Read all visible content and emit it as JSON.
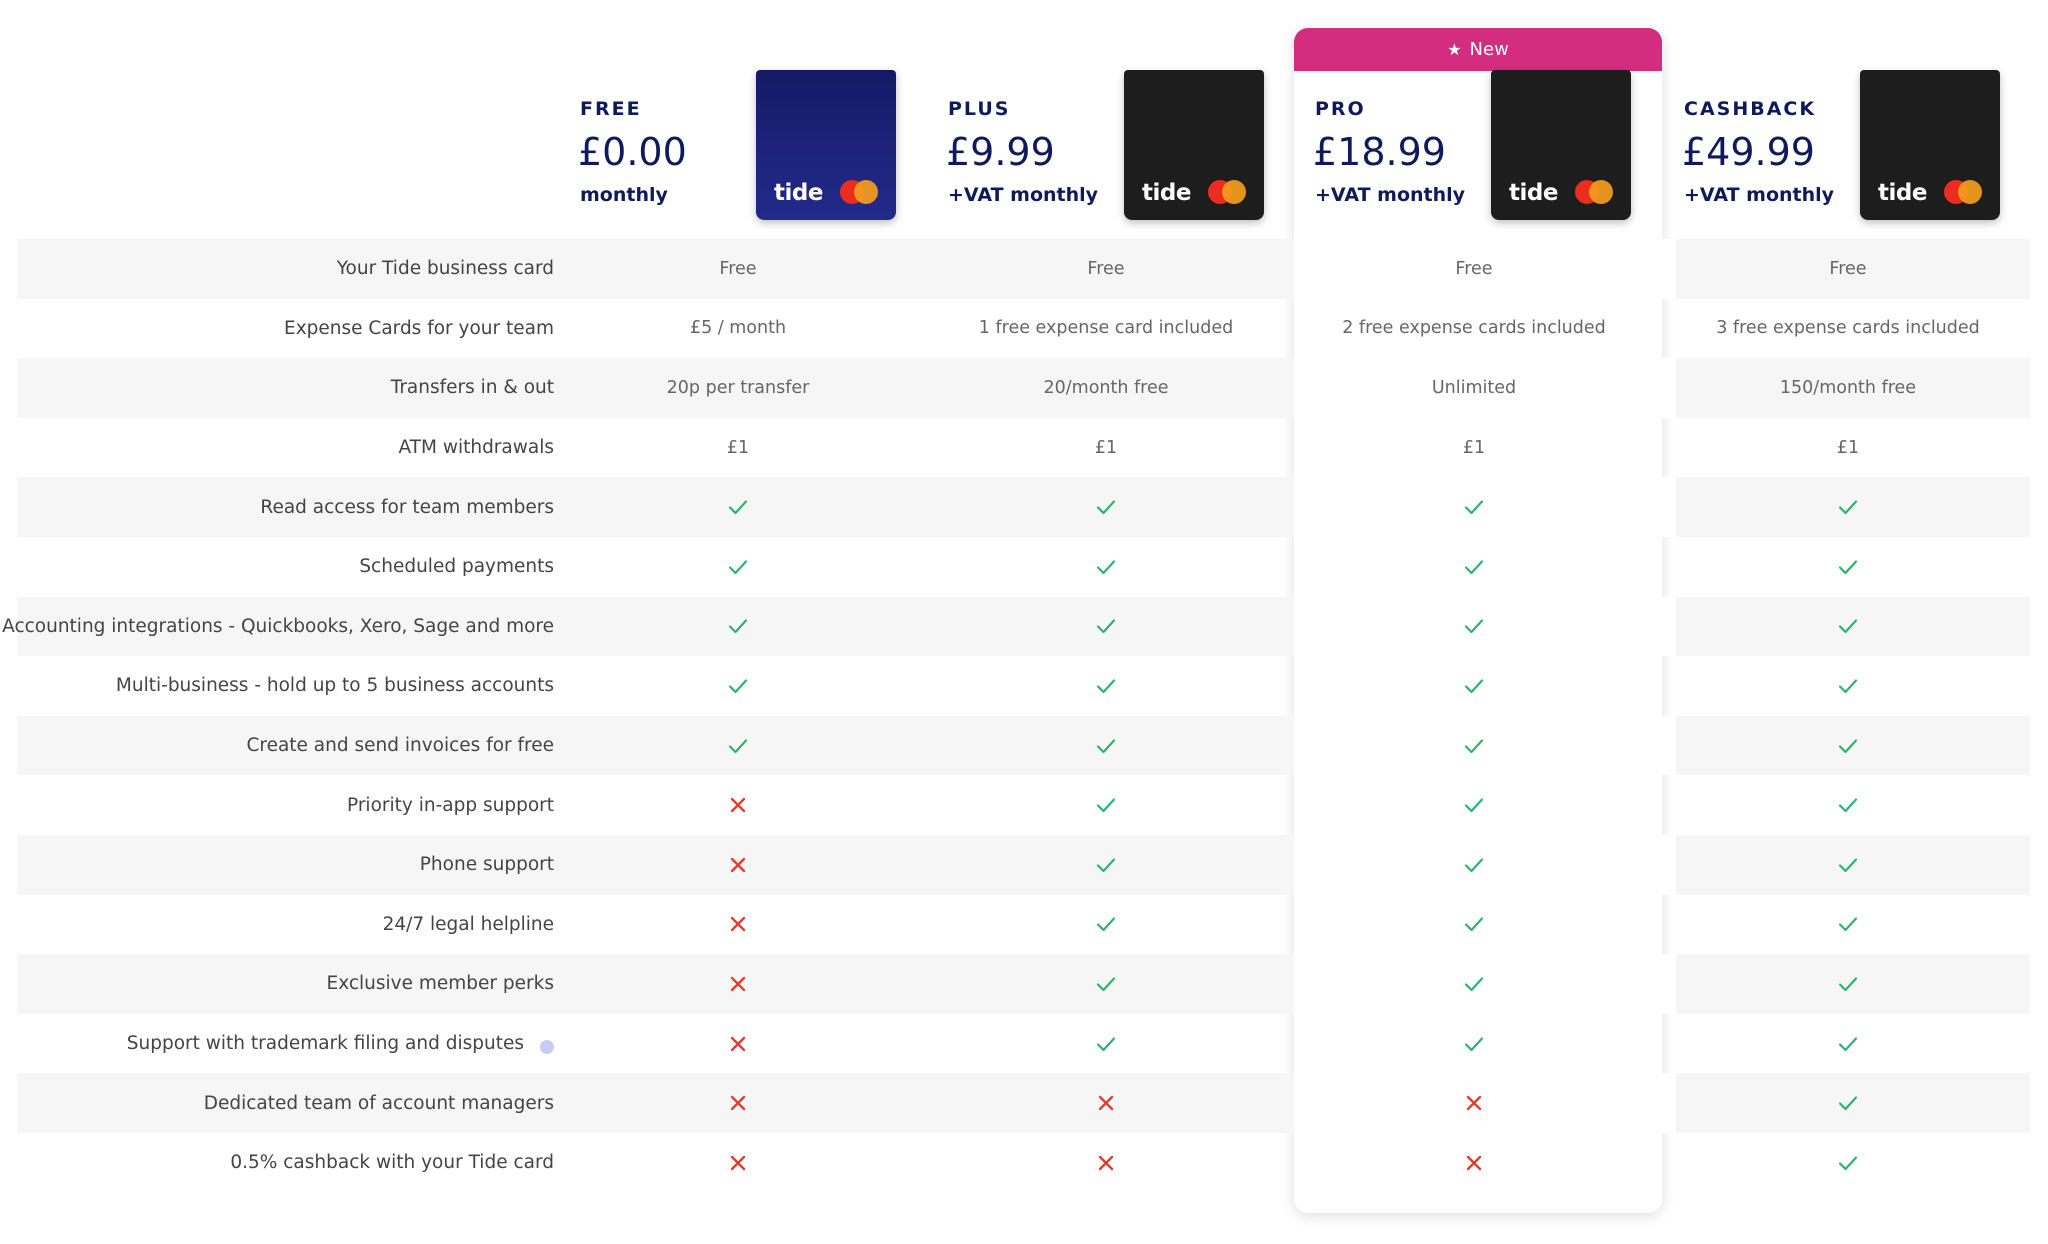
{
  "badge": {
    "star": "★",
    "label": "New"
  },
  "plans": [
    {
      "name": "FREE",
      "price": "£0.00",
      "period": "monthly",
      "card_brand": "tide",
      "card_style": "blue"
    },
    {
      "name": "PLUS",
      "price": "£9.99",
      "period": "+VAT monthly",
      "card_brand": "tide",
      "card_style": "black"
    },
    {
      "name": "PRO",
      "price": "£18.99",
      "period": "+VAT monthly",
      "card_brand": "tide",
      "card_style": "black"
    },
    {
      "name": "CASHBACK",
      "price": "£49.99",
      "period": "+VAT monthly",
      "card_brand": "tide",
      "card_style": "black"
    }
  ],
  "colors": {
    "navy": "#0f1a5c",
    "pink": "#d42c7f",
    "check": "#2db36f",
    "cross": "#e8392b",
    "row_shade": "#f6f6f6"
  },
  "rows": [
    {
      "label": "Your Tide business card",
      "values": [
        "Free",
        "Free",
        "Free",
        "Free"
      ]
    },
    {
      "label": "Expense Cards for your team",
      "values": [
        "£5 / month",
        "1 free expense card included",
        "2 free expense cards included",
        "3 free expense cards included"
      ]
    },
    {
      "label": "Transfers in & out",
      "values": [
        "20p per transfer",
        "20/month free",
        "Unlimited",
        "150/month free"
      ]
    },
    {
      "label": "ATM withdrawals",
      "values": [
        "£1",
        "£1",
        "£1",
        "£1"
      ]
    },
    {
      "label": "Read access for team members",
      "values": [
        true,
        true,
        true,
        true
      ]
    },
    {
      "label": "Scheduled payments",
      "values": [
        true,
        true,
        true,
        true
      ]
    },
    {
      "label": "Accounting integrations - Quickbooks, Xero, Sage and more",
      "values": [
        true,
        true,
        true,
        true
      ]
    },
    {
      "label": "Multi-business - hold up to 5 business accounts",
      "values": [
        true,
        true,
        true,
        true
      ]
    },
    {
      "label": "Create and send invoices for free",
      "values": [
        true,
        true,
        true,
        true
      ]
    },
    {
      "label": "Priority in-app support",
      "values": [
        false,
        true,
        true,
        true
      ]
    },
    {
      "label": "Phone support",
      "values": [
        false,
        true,
        true,
        true
      ]
    },
    {
      "label": "24/7 legal helpline",
      "values": [
        false,
        true,
        true,
        true
      ]
    },
    {
      "label": "Exclusive member perks",
      "values": [
        false,
        true,
        true,
        true
      ]
    },
    {
      "label": "Support with trademark filing and disputes",
      "values": [
        false,
        true,
        true,
        true
      ],
      "info_icon": "info-icon"
    },
    {
      "label": "Dedicated team of account managers",
      "values": [
        false,
        false,
        false,
        true
      ]
    },
    {
      "label": "0.5% cashback with your Tide card",
      "values": [
        false,
        false,
        false,
        true
      ]
    }
  ]
}
